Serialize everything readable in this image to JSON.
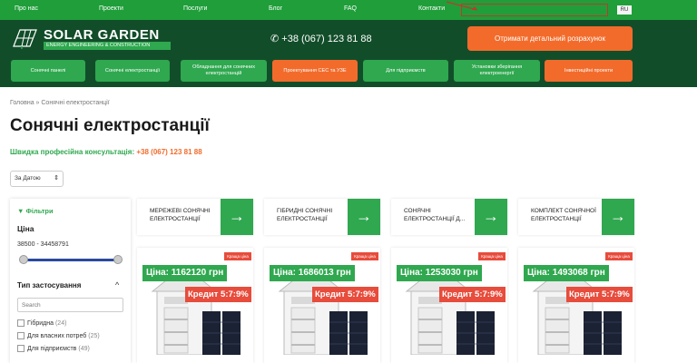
{
  "topbar": {
    "links": [
      "Про нас",
      "Проекти",
      "Послуги",
      "Блог",
      "FAQ",
      "Контакти"
    ],
    "lang": "RU"
  },
  "header": {
    "logo_title": "SOLAR GARDEN",
    "logo_subtitle": "ENERGY ENGINEERING & CONSTRUCTION",
    "phone": "+38 (067) 123 81 88",
    "cta": "Отримати детальний розрахунок"
  },
  "nav": [
    {
      "label": "Сонячні панелі",
      "style": "green"
    },
    {
      "label": "Сонячні електростанції",
      "style": "green"
    },
    {
      "label": "Обладнання для сонячних електростанцій",
      "style": "green"
    },
    {
      "label": "Проектування СЕС та УЗЕ",
      "style": "orange"
    },
    {
      "label": "Для підприємств",
      "style": "green"
    },
    {
      "label": "Установки зберігання електроенергії",
      "style": "green"
    },
    {
      "label": "Інвестиційні проекти",
      "style": "orange"
    }
  ],
  "breadcrumb": "Головна » Сонячні електростанції",
  "page_title": "Сонячні електростанції",
  "consult": {
    "label": "Швидка професійна консультація:",
    "phone": "+38 (067) 123 81 88"
  },
  "sort": {
    "value": "За Датою"
  },
  "filters": {
    "title": "Фільтри",
    "price_label": "Ціна",
    "price_range": "38500 - 34458791",
    "price_slider": {
      "min": 38500,
      "max": 34458791,
      "low": 38500,
      "high": 34458791
    },
    "use_type_label": "Тип застосування",
    "search_placeholder": "Search",
    "options": [
      {
        "label": "Гібридна",
        "count": "(24)"
      },
      {
        "label": "Для власних потреб",
        "count": "(25)"
      },
      {
        "label": "Для підприємств",
        "count": "(49)"
      }
    ]
  },
  "categories": [
    {
      "label": "МЕРЕЖЕВІ СОНЯЧНІ ЕЛЕКТРОСТАНЦІЇ"
    },
    {
      "label": "ГІБРИДНІ СОНЯЧНІ ЕЛЕКТРОСТАНЦІЇ"
    },
    {
      "label": "СОНЯЧНІ ЕЛЕКТРОСТАНЦІЇ Д..."
    },
    {
      "label": "КОМПЛЕКТ СОНЯЧНОЇ ЕЛЕКТРОСТАНЦІЇ"
    }
  ],
  "products": [
    {
      "badge": "Краща ціна",
      "price": "Ціна: 1162120 грн",
      "credit": "Кредит 5:7:9%"
    },
    {
      "badge": "Краща ціна",
      "price": "Ціна: 1686013 грн",
      "credit": "Кредит 5:7:9%"
    },
    {
      "badge": "Краща ціна",
      "price": "Ціна: 1253030 грн",
      "credit": "Кредит 5:7:9%"
    },
    {
      "badge": "Краща ціна",
      "price": "Ціна: 1493068 грн",
      "credit": "Кредит 5:7:9%"
    }
  ],
  "colors": {
    "brand_green": "#2fa84f",
    "dark_green": "#124d2a",
    "accent_orange": "#f26b2b",
    "badge_red": "#e74c3c"
  },
  "icons": [
    "logo-panel-icon",
    "phone-icon",
    "filter-icon",
    "chevron-up-icon",
    "arrow-right-icon"
  ]
}
